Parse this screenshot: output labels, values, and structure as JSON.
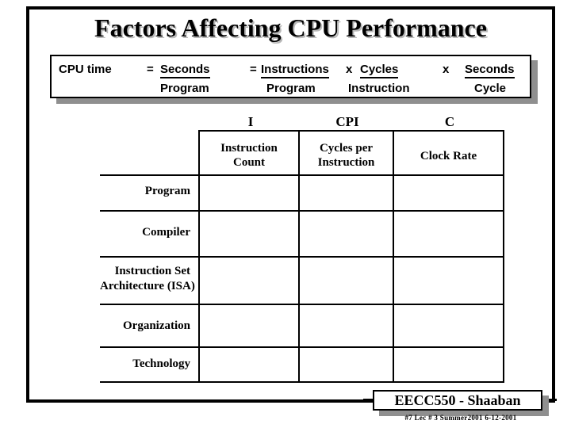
{
  "slide": {
    "title": "Factors Affecting CPU Performance",
    "background_color": "#ffffff",
    "frame_color": "#000000",
    "shadow_color": "#8f8f8f"
  },
  "formula": {
    "lhs": "CPU time",
    "eq1": "=",
    "term1_num": "Seconds",
    "term1_den": "Program",
    "eq2": "=",
    "term2_num": "Instructions",
    "term2_den": "Program",
    "mul1": "x",
    "term3_num": "Cycles",
    "term3_den": "Instruction",
    "mul2": "x",
    "term4_num": "Seconds",
    "term4_den": "Cycle"
  },
  "matrix": {
    "symbols": [
      "I",
      "CPI",
      "C"
    ],
    "column_headers": [
      "Instruction\nCount",
      "Cycles per\nInstruction",
      "Clock Rate"
    ],
    "column_headers_lines": [
      [
        "Instruction",
        "Count"
      ],
      [
        "Cycles per",
        "Instruction"
      ],
      [
        "Clock Rate"
      ]
    ],
    "row_labels": [
      "Program",
      "Compiler",
      "Instruction Set\nArchitecture (ISA)",
      "Organization",
      "Technology"
    ],
    "row_labels_lines": [
      [
        "Program"
      ],
      [
        "Compiler"
      ],
      [
        "Instruction Set",
        "Architecture (ISA)"
      ],
      [
        "Organization"
      ],
      [
        "Technology"
      ]
    ],
    "cells": [
      [
        "",
        "",
        ""
      ],
      [
        "",
        "",
        ""
      ],
      [
        "",
        "",
        ""
      ],
      [
        "",
        "",
        ""
      ],
      [
        "",
        "",
        ""
      ]
    ]
  },
  "footer": {
    "course": "EECC550 - Shaaban",
    "meta": "#7   Lec # 3    Summer2001   6-12-2001"
  }
}
